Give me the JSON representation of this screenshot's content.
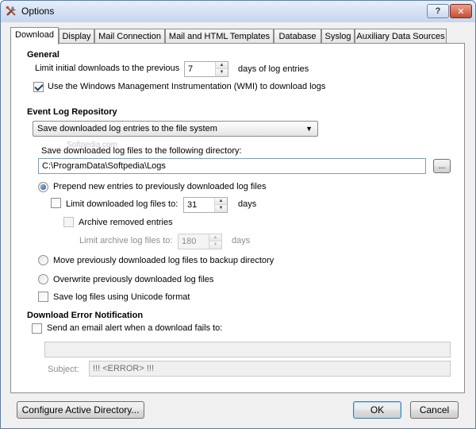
{
  "window": {
    "title": "Options",
    "help_label": "?",
    "close_label": "✕"
  },
  "tabs": [
    {
      "label": "Download",
      "active": true
    },
    {
      "label": "Display"
    },
    {
      "label": "Mail Connection"
    },
    {
      "label": "Mail and HTML Templates"
    },
    {
      "label": "Database"
    },
    {
      "label": "Syslog"
    },
    {
      "label": "Auxiliary Data Sources"
    }
  ],
  "general": {
    "heading": "General",
    "limit_label": "Limit initial downloads to the previous",
    "limit_value": "7",
    "limit_suffix": "days of log entries",
    "wmi_label": "Use the Windows Management Instrumentation (WMI) to download logs",
    "wmi_checked": true
  },
  "repository": {
    "heading": "Event Log Repository",
    "select_value": "Save downloaded log entries to the file system",
    "dir_label": "Save downloaded log files to the following directory:",
    "dir_value": "C:\\ProgramData\\Softpedia\\Logs",
    "browse_label": "...",
    "watermark": "Softpedia.com",
    "prepend_label": "Prepend new entries to previously downloaded log files",
    "limit_files_label": "Limit downloaded log files to:",
    "limit_files_value": "31",
    "limit_files_suffix": "days",
    "archive_label": "Archive removed entries",
    "limit_archive_label": "Limit archive log files to:",
    "limit_archive_value": "180",
    "limit_archive_suffix": "days",
    "move_label": "Move previously downloaded log files to backup directory",
    "overwrite_label": "Overwrite previously downloaded log files",
    "unicode_label": "Save log files using Unicode format"
  },
  "error_notification": {
    "heading": "Download Error Notification",
    "email_label": "Send an email alert when a download fails to:",
    "email_value": "",
    "subject_label": "Subject:",
    "subject_value": "!!! <ERROR> !!!"
  },
  "footer": {
    "configure_label": "Configure Active Directory...",
    "ok_label": "OK",
    "cancel_label": "Cancel"
  },
  "colors": {
    "title_bar": "#c5d6ee",
    "close_button": "#c44e33",
    "default_button_border": "#3c7fb1"
  }
}
